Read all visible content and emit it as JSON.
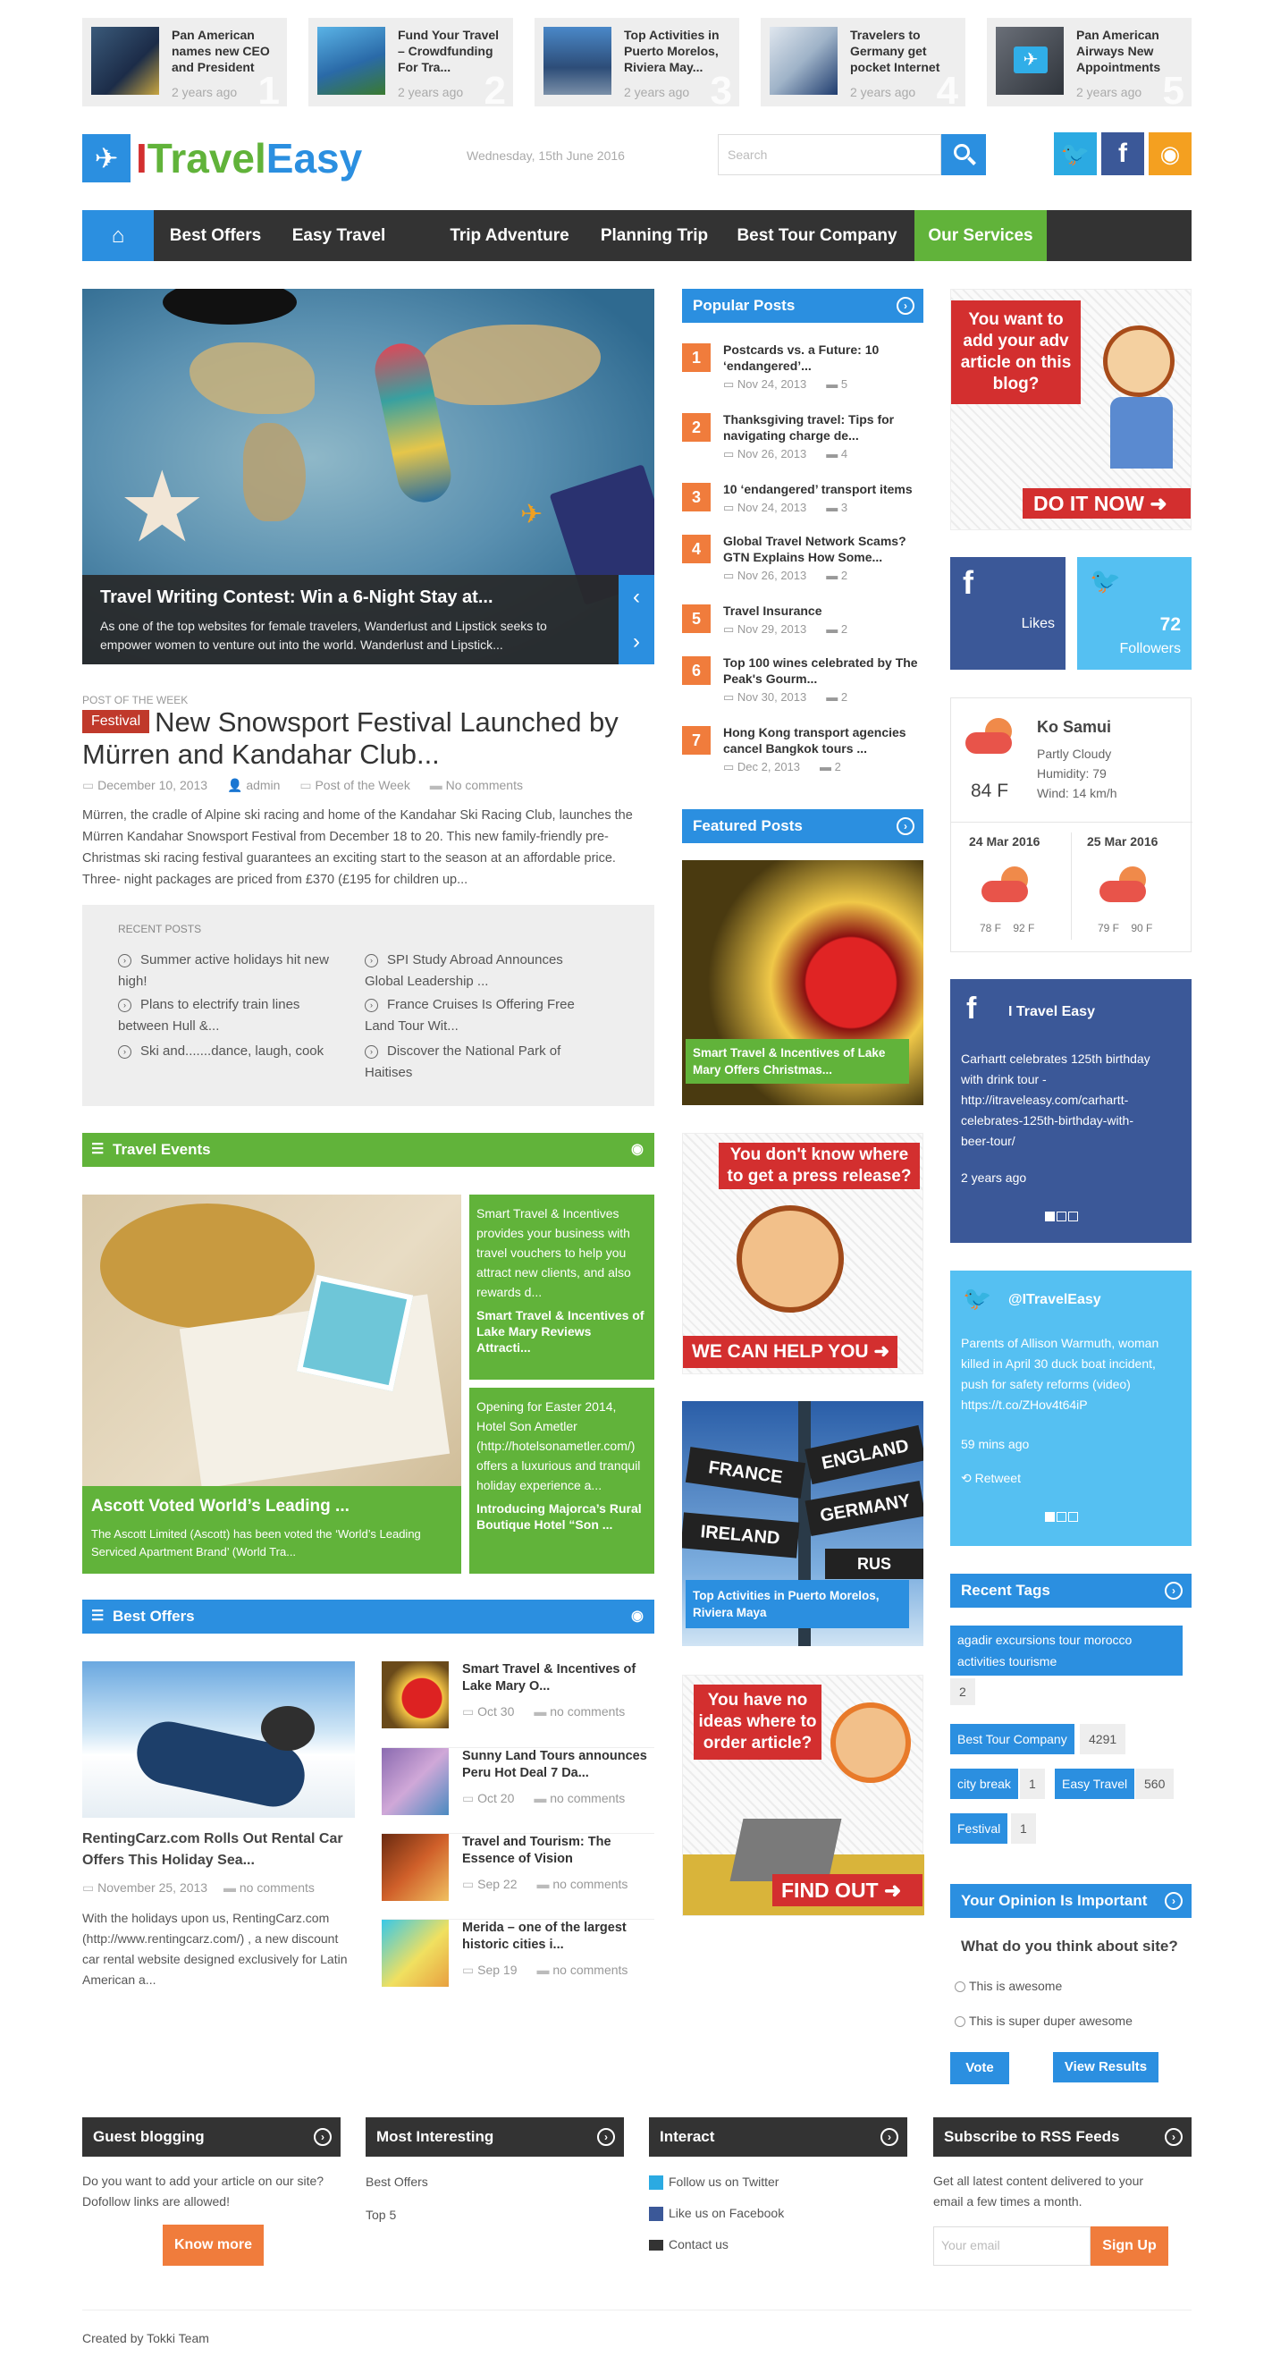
{
  "ticker": [
    {
      "title": "Pan American names new CEO and President",
      "date": "2 years ago",
      "num": "1"
    },
    {
      "title": "Fund Your Travel – Crowdfunding For Tra...",
      "date": "2 years ago",
      "num": "2"
    },
    {
      "title": "Top Activities in Puerto Morelos, Riviera May...",
      "date": "2 years ago",
      "num": "3"
    },
    {
      "title": "Travelers to Germany get pocket Internet",
      "date": "2 years ago",
      "num": "4"
    },
    {
      "title": "Pan American Airways New Appointments",
      "date": "2 years ago",
      "num": "5"
    }
  ],
  "header": {
    "logo_i": "I",
    "logo_travel": "Travel",
    "logo_easy": "Easy",
    "date": "Wednesday, 15th June 2016",
    "search_placeholder": "Search"
  },
  "nav": {
    "items": [
      "Best Offers",
      "Easy Travel",
      "Trip Adventure",
      "Planning Trip",
      "Best Tour Company",
      "Our Services"
    ]
  },
  "slider": {
    "title": "Travel Writing Contest: Win a 6-Night Stay at...",
    "text": "As one of the top websites for female travelers, Wanderlust and Lipstick seeks to empower women to venture out into the world. Wanderlust and Lipstick..."
  },
  "potw": {
    "label": "POST OF THE WEEK",
    "badge": "Festival",
    "title": "New Snowsport Festival Launched by Mürren and Kandahar Club...",
    "date": "December 10, 2013",
    "author": "admin",
    "category": "Post of the Week",
    "comments": "No comments",
    "excerpt": "Mürren, the cradle of Alpine ski racing and home of the Kandahar Ski Racing Club, launches the Mürren Kandahar Snowsport Festival from December 18 to 20. This new family-friendly pre-Christmas ski racing festival guarantees an exciting start to the season at an affordable price.  Three- night packages are priced from £370 (£195 for children up..."
  },
  "recent_posts": {
    "label": "RECENT POSTS",
    "left": [
      "Summer active holidays hit new high!",
      "Plans to electrify train lines between Hull &...",
      "Ski and.......dance, laugh, cook"
    ],
    "right": [
      "SPI Study Abroad Announces Global Leadership ...",
      "France Cruises Is Offering Free Land Tour Wit...",
      "Discover the National Park of Haitises"
    ]
  },
  "travel_events": {
    "heading": "Travel Events",
    "main_title": "Ascott Voted World’s Leading ...",
    "main_text": "The Ascott Limited (Ascott) has been voted the ‘World’s Leading Serviced Apartment Brand’ (World Tra...",
    "side1_text": "Smart Travel & Incentives provides your business with travel vouchers to help you attract new clients, and also rewards d...",
    "side1_title": "Smart Travel & Incentives of Lake Mary Reviews Attracti...",
    "side2_text": "Opening for Easter 2014, Hotel Son Ametler (http://hotelsonametler.com/) offers a luxurious and tranquil holiday experience a...",
    "side2_title": "Introducing Majorca’s Rural Boutique Hotel “Son ..."
  },
  "best_offers": {
    "heading": "Best Offers",
    "main_title": "RentingCarz.com Rolls Out Rental Car Offers This Holiday Sea...",
    "main_date": "November 25, 2013",
    "main_comments": "no comments",
    "main_text": "With the holidays upon us, RentingCarz.com (http://www.rentingcarz.com/) , a new discount car rental website designed exclusively for Latin American a...",
    "items": [
      {
        "title": "Smart Travel & Incentives of Lake Mary O...",
        "date": "Oct 30",
        "comments": "no comments"
      },
      {
        "title": "Sunny Land Tours announces Peru Hot Deal 7 Da...",
        "date": "Oct 20",
        "comments": "no comments"
      },
      {
        "title": "Travel and Tourism: The Essence of Vision",
        "date": "Sep 22",
        "comments": "no comments"
      },
      {
        "title": "Merida – one of the largest historic cities i...",
        "date": "Sep 19",
        "comments": "no comments"
      }
    ]
  },
  "popular": {
    "heading": "Popular Posts",
    "items": [
      {
        "num": "1",
        "title": "Postcards vs. a Future: 10 ‘endangered’...",
        "date": "Nov 24, 2013",
        "comments": "5"
      },
      {
        "num": "2",
        "title": "Thanksgiving travel: Tips for navigating charge de...",
        "date": "Nov 26, 2013",
        "comments": "4"
      },
      {
        "num": "3",
        "title": "10 ‘endangered’ transport items",
        "date": "Nov 24, 2013",
        "comments": "3"
      },
      {
        "num": "4",
        "title": "Global Travel Network Scams? GTN Explains How Some...",
        "date": "Nov 26, 2013",
        "comments": "2"
      },
      {
        "num": "5",
        "title": "Travel Insurance",
        "date": "Nov 29, 2013",
        "comments": "2"
      },
      {
        "num": "6",
        "title": "Top 100 wines celebrated by The Peak's Gourm...",
        "date": "Nov 30, 2013",
        "comments": "2"
      },
      {
        "num": "7",
        "title": "Hong Kong transport agencies cancel Bangkok tours ...",
        "date": "Dec 2, 2013",
        "comments": "2"
      }
    ]
  },
  "featured": {
    "heading": "Featured Posts",
    "caption1": "Smart Travel & Incentives of Lake Mary Offers Christmas...",
    "caption2": "Top Activities in Puerto Morelos, Riviera Maya"
  },
  "ads": {
    "ad1_text": "You want to add your adv article on this blog?",
    "ad1_cta": "DO IT NOW",
    "ad2_text": "You don't know where to get a press release?",
    "ad2_cta": "WE CAN HELP YOU",
    "ad3_text": "You have no ideas where to order article?",
    "ad3_cta": "FIND OUT",
    "signs": [
      "FRANCE",
      "ENGLAND",
      "GERMANY",
      "IRELAND",
      "RUS"
    ]
  },
  "social": {
    "likes": "Likes",
    "followers_count": "72",
    "followers": "Followers"
  },
  "weather": {
    "city": "Ko Samui",
    "condition": "Partly Cloudy",
    "humidity": "Humidity: 79",
    "wind": "Wind: 14 km/h",
    "temp": "84 F",
    "day1": "24 Mar 2016",
    "day1_temps": "78 F    92 F",
    "day2": "25 Mar 2016",
    "day2_temps": "79 F    90 F"
  },
  "facebook_box": {
    "title": "I Travel Easy",
    "text": "Carhartt celebrates 125th birthday with drink tour - http://itraveleasy.com/carhartt-celebrates-125th-birthday-with-beer-tour/",
    "time": "2 years ago"
  },
  "twitter_box": {
    "handle": "@ITravelEasy",
    "text": "Parents of Allison Warmuth, woman killed in April 30 duck boat incident, push for safety reforms (video) https://t.co/ZHov4t64iP",
    "time": "59 mins ago",
    "retweet": "Retweet"
  },
  "tags": {
    "heading": "Recent Tags",
    "items": [
      {
        "name": "agadir excursions tour morocco activities tourisme",
        "count": "2"
      },
      {
        "name": "Best Tour Company",
        "count": "4291"
      },
      {
        "name": "city break",
        "count": "1"
      },
      {
        "name": "Easy Travel",
        "count": "560"
      },
      {
        "name": "Festival",
        "count": "1"
      }
    ]
  },
  "poll": {
    "heading": "Your Opinion Is Important",
    "question": "What do you think about site?",
    "options": [
      "This is awesome",
      "This is super duper awesome"
    ],
    "vote": "Vote",
    "results": "View Results"
  },
  "footer": {
    "guest_heading": "Guest blogging",
    "guest_text": "Do you want to add your article on our site? Dofollow links are allowed!",
    "guest_button": "Know more",
    "interesting_heading": "Most Interesting",
    "interesting_links": [
      "Best Offers",
      "Top 5"
    ],
    "interact_heading": "Interact",
    "interact_links": [
      "Follow us on Twitter",
      "Like us on Facebook",
      "Contact us"
    ],
    "rss_heading": "Subscribe to RSS Feeds",
    "rss_text": "Get all latest content delivered to your email a few times a month.",
    "email_placeholder": "Your email",
    "signup": "Sign Up",
    "credit": "Created by Tokki Team"
  },
  "colors": {
    "blue": "#2b8fe0",
    "green": "#61b33a",
    "orange": "#f07c3c",
    "dark": "#333333",
    "red": "#d32f2f",
    "fb": "#3b5898",
    "tw": "#55c0f2"
  }
}
